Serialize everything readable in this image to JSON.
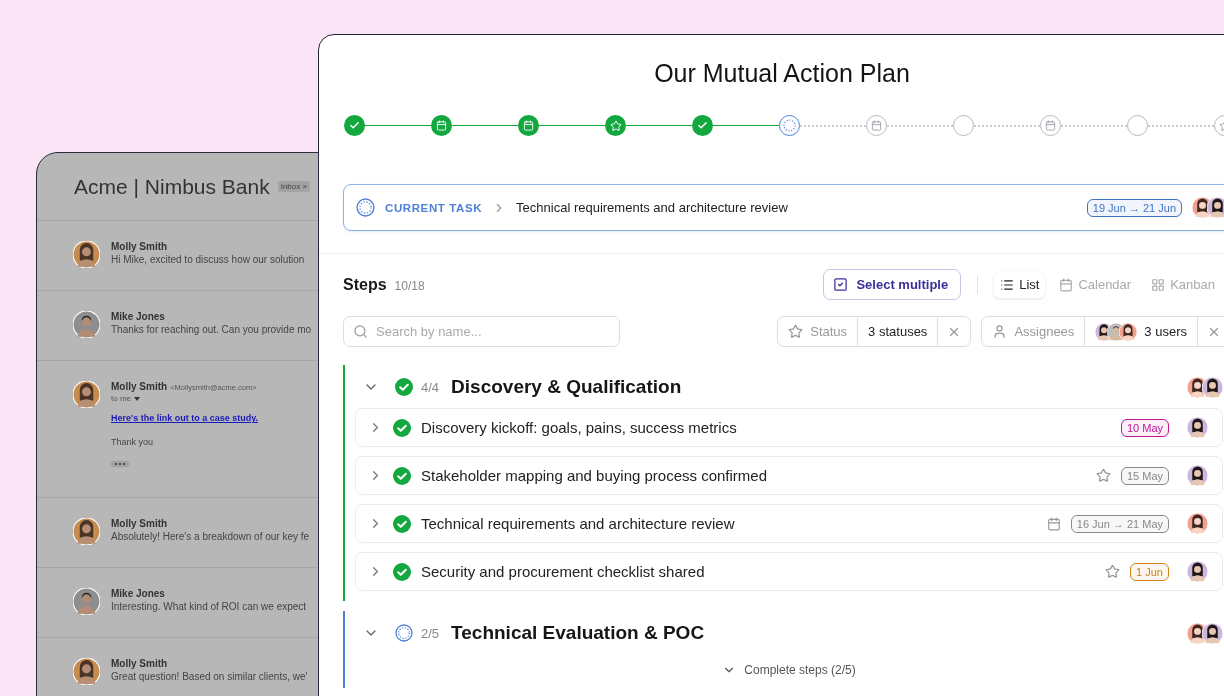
{
  "email": {
    "title": "Acme | Nimbus Bank",
    "label": "Inbox",
    "label_close": "×",
    "messages": [
      {
        "kind": "collapsed",
        "sender": "Molly Smith",
        "avatar": {
          "kind": "woman"
        },
        "snippet": "Hi Mike, excited to discuss how our solution"
      },
      {
        "kind": "collapsed",
        "sender": "Mike Jones",
        "avatar": {
          "kind": "man"
        },
        "snippet": "Thanks for reaching out. Can you provide mo"
      },
      {
        "kind": "expanded",
        "sender": "Molly Smith",
        "avatar": {
          "kind": "woman"
        },
        "address": "<Mollysmith@acme.com>",
        "to": "to me",
        "link": "Here's the link out to a case study.",
        "body": "Thank you"
      },
      {
        "kind": "collapsed",
        "sender": "Molly Smith",
        "avatar": {
          "kind": "woman"
        },
        "snippet": "Absolutely! Here's a breakdown of our key fe"
      },
      {
        "kind": "collapsed",
        "sender": "Mike Jones",
        "avatar": {
          "kind": "man"
        },
        "snippet": "Interesting. What kind of ROI can we expect"
      },
      {
        "kind": "collapsed",
        "sender": "Molly Smith",
        "avatar": {
          "kind": "woman"
        },
        "snippet": "Great question! Based on similar clients, we'"
      }
    ]
  },
  "plan": {
    "title": "Our Mutual Action Plan",
    "milestones": [
      {
        "kind": "check",
        "done": true,
        "current": false
      },
      {
        "kind": "calendar",
        "done": true,
        "current": false
      },
      {
        "kind": "calendar",
        "done": true,
        "current": false
      },
      {
        "kind": "star",
        "done": true,
        "current": false
      },
      {
        "kind": "check",
        "done": true,
        "current": false
      },
      {
        "kind": "dotted",
        "done": false,
        "current": true
      },
      {
        "kind": "calendar",
        "done": false,
        "current": false
      },
      {
        "kind": "plain",
        "done": false,
        "current": false
      },
      {
        "kind": "calendar",
        "done": false,
        "current": false
      },
      {
        "kind": "plain",
        "done": false,
        "current": false
      },
      {
        "kind": "star",
        "done": false,
        "current": false
      }
    ],
    "current_task": {
      "label": "CURRENT TASK",
      "title": "Technical requirements and architecture review",
      "dates": "19 Jun → 21 Jun",
      "avatars": [
        {
          "kind": "coral"
        },
        {
          "kind": "violet"
        }
      ]
    },
    "steps_header": {
      "title": "Steps",
      "count": "10/18",
      "select_multiple": "Select multiple",
      "views": [
        {
          "label": "List",
          "kind": "list",
          "selected": true
        },
        {
          "label": "Calendar",
          "kind": "calendar",
          "selected": false
        },
        {
          "label": "Kanban",
          "kind": "grid",
          "selected": false
        }
      ]
    },
    "search": {
      "placeholder": "Search by name..."
    },
    "filters": [
      {
        "kind": "star",
        "label": "Status",
        "value": "3 statuses"
      },
      {
        "kind": "person",
        "label": "Assignees",
        "value": "3 users",
        "avatars": [
          {
            "kind": "violet"
          },
          {
            "kind": "grey"
          },
          {
            "kind": "coral"
          }
        ]
      }
    ],
    "sections": [
      {
        "title": "Discovery & Qualification",
        "progress": "4/4",
        "done": true,
        "expanded": true,
        "avatars": [
          {
            "kind": "coral"
          },
          {
            "kind": "violet"
          }
        ],
        "steps": [
          {
            "title": "Discovery kickoff: goals, pains, success metrics",
            "done": true,
            "kind": "plain",
            "date": "10 May",
            "color": "#c0169f",
            "avatar": {
              "kind": "violet"
            }
          },
          {
            "title": "Stakeholder mapping and buying process confirmed",
            "done": true,
            "kind": "star",
            "date": "15 May",
            "color": "#888888",
            "avatar": {
              "kind": "violet"
            }
          },
          {
            "title": "Technical requirements and architecture review",
            "done": true,
            "kind": "calendar",
            "date": "16 Jun → 21 May",
            "color": "#888888",
            "avatar": {
              "kind": "coral"
            }
          },
          {
            "title": "Security and procurement checklist shared",
            "done": true,
            "kind": "star",
            "date": "1 Jun",
            "color": "#d0801a",
            "avatar": {
              "kind": "violet"
            }
          }
        ]
      },
      {
        "title": "Technical Evaluation & POC",
        "progress": "2/5",
        "done": false,
        "expanded": true,
        "avatars": [
          {
            "kind": "coral"
          },
          {
            "kind": "violet"
          }
        ],
        "toggle": "Complete steps (2/5)"
      }
    ]
  }
}
